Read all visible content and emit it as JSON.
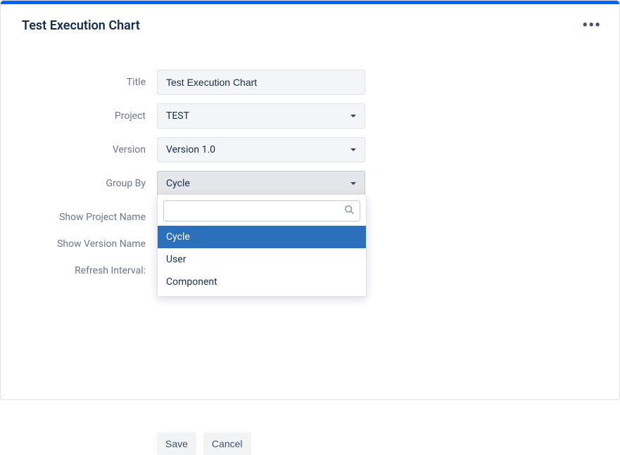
{
  "header": {
    "title": "Test Execution Chart"
  },
  "form": {
    "labels": {
      "title": "Title",
      "project": "Project",
      "version": "Version",
      "groupBy": "Group By",
      "showProjectName": "Show Project Name",
      "showVersionName": "Show Version Name",
      "refreshInterval": "Refresh Interval:"
    },
    "values": {
      "title": "Test Execution Chart",
      "project": "TEST",
      "version": "Version 1.0",
      "groupBy": "Cycle"
    }
  },
  "dropdown": {
    "searchValue": "",
    "options": {
      "o0": "Cycle",
      "o1": "User",
      "o2": "Component"
    }
  },
  "buttons": {
    "save": "Save",
    "cancel": "Cancel"
  }
}
